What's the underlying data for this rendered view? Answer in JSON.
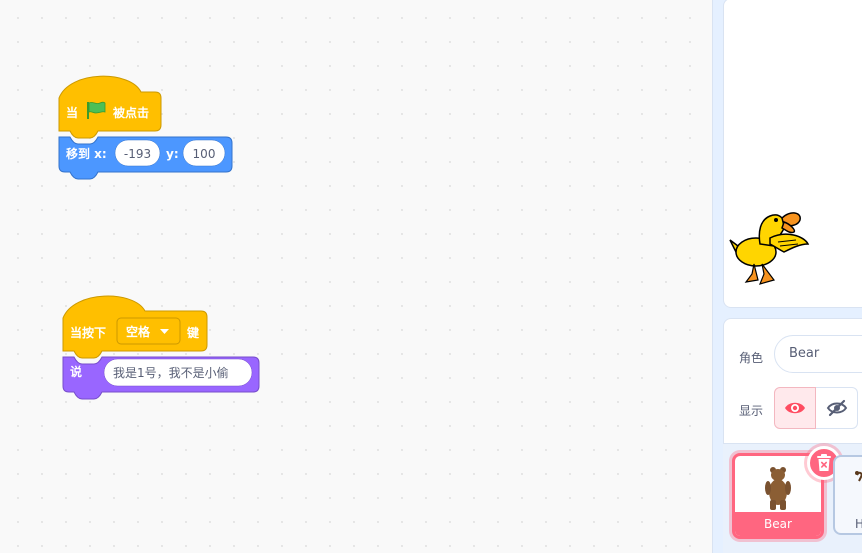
{
  "scripts": {
    "flag_hat": {
      "prefix": "当",
      "suffix": "被点击"
    },
    "goto": {
      "label": "移到 x:",
      "x_value": "-193",
      "y_label": "y:",
      "y_value": "100"
    },
    "key_hat": {
      "prefix": "当按下",
      "key": "空格",
      "suffix": "键"
    },
    "say": {
      "label": "说",
      "message": "我是1号，我不是小偷"
    }
  },
  "sprite_info": {
    "sprite_label": "角色",
    "sprite_name": "Bear",
    "show_label": "显示"
  },
  "sprite_list": {
    "selected": "Bear",
    "second_partial": "H"
  },
  "colors": {
    "events": "#ffbf00",
    "motion": "#4c97ff",
    "looks": "#9966ff",
    "selection": "#ff6680"
  }
}
